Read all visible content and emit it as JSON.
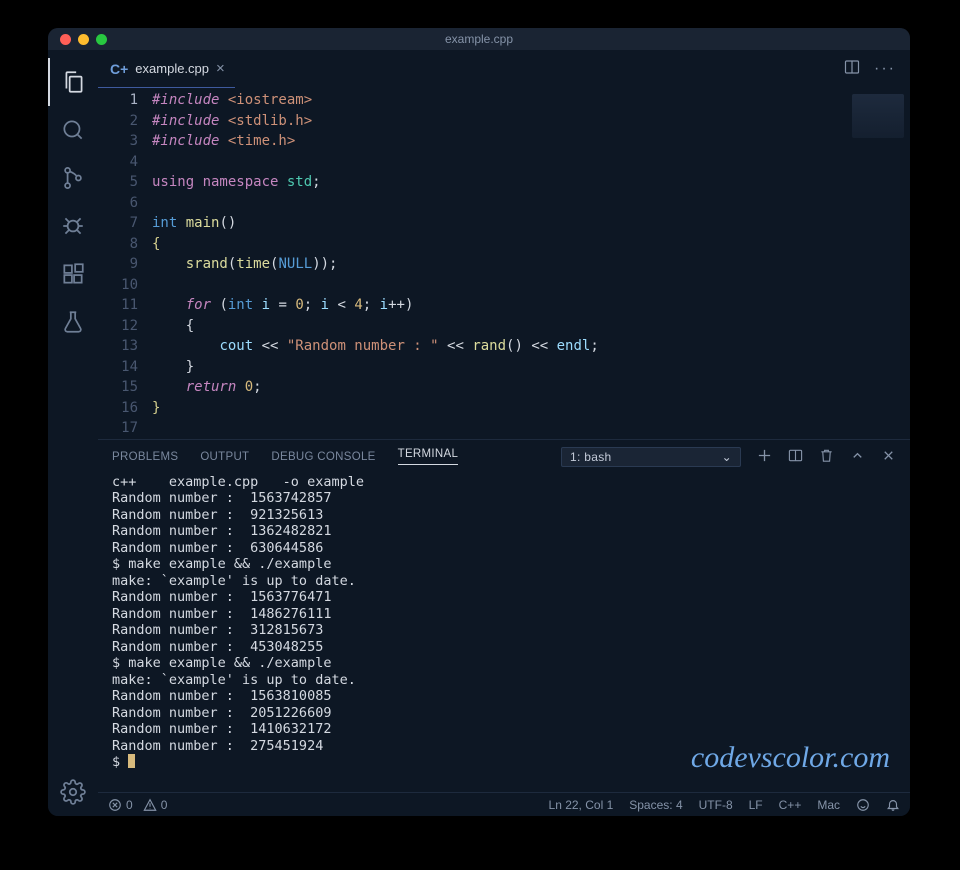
{
  "window": {
    "title": "example.cpp"
  },
  "tab": {
    "filename": "example.cpp",
    "icon_label": "C+"
  },
  "code_tokens": [
    [
      [
        "k-include",
        "#include "
      ],
      [
        "k-lib",
        "<iostream>"
      ]
    ],
    [
      [
        "k-include",
        "#include "
      ],
      [
        "k-lib",
        "<stdlib.h>"
      ]
    ],
    [
      [
        "k-include",
        "#include "
      ],
      [
        "k-lib",
        "<time.h>"
      ]
    ],
    [],
    [
      [
        "k-keyword",
        "using "
      ],
      [
        "k-keyword",
        "namespace "
      ],
      [
        "k-namespace",
        "std"
      ],
      [
        "k-punc",
        ";"
      ]
    ],
    [],
    [
      [
        "k-type",
        "int "
      ],
      [
        "k-func",
        "main"
      ],
      [
        "k-punc",
        "()"
      ]
    ],
    [
      [
        "k-brace-y",
        "{"
      ]
    ],
    [
      [
        "",
        "    "
      ],
      [
        "k-func",
        "srand"
      ],
      [
        "k-punc",
        "("
      ],
      [
        "k-func",
        "time"
      ],
      [
        "k-punc",
        "("
      ],
      [
        "k-const",
        "NULL"
      ],
      [
        "k-punc",
        "));"
      ]
    ],
    [],
    [
      [
        "",
        "    "
      ],
      [
        "k-keyword-i",
        "for "
      ],
      [
        "k-punc",
        "("
      ],
      [
        "k-type",
        "int "
      ],
      [
        "k-var",
        "i"
      ],
      [
        "k-punc",
        " = "
      ],
      [
        "k-num",
        "0"
      ],
      [
        "k-punc",
        "; "
      ],
      [
        "k-var",
        "i"
      ],
      [
        "k-punc",
        " < "
      ],
      [
        "k-num",
        "4"
      ],
      [
        "k-punc",
        "; "
      ],
      [
        "k-var",
        "i"
      ],
      [
        "k-punc",
        "++)"
      ]
    ],
    [
      [
        "",
        "    "
      ],
      [
        "k-brace",
        "{"
      ]
    ],
    [
      [
        "",
        "        "
      ],
      [
        "k-var",
        "cout"
      ],
      [
        "k-punc",
        " << "
      ],
      [
        "k-str",
        "\"Random number : \""
      ],
      [
        "k-punc",
        " << "
      ],
      [
        "k-func",
        "rand"
      ],
      [
        "k-punc",
        "() << "
      ],
      [
        "k-var",
        "endl"
      ],
      [
        "k-punc",
        ";"
      ]
    ],
    [
      [
        "",
        "    "
      ],
      [
        "k-brace",
        "}"
      ]
    ],
    [
      [
        "",
        "    "
      ],
      [
        "k-keyword-i",
        "return "
      ],
      [
        "k-num",
        "0"
      ],
      [
        "k-punc",
        ";"
      ]
    ],
    [
      [
        "k-brace-y",
        "}"
      ]
    ],
    []
  ],
  "line_count": 17,
  "panel": {
    "tabs": {
      "problems": "PROBLEMS",
      "output": "OUTPUT",
      "debug": "DEBUG CONSOLE",
      "terminal": "TERMINAL"
    },
    "terminal_selector": "1: bash"
  },
  "terminal_lines": [
    "c++    example.cpp   -o example",
    "Random number :  1563742857",
    "Random number :  921325613",
    "Random number :  1362482821",
    "Random number :  630644586",
    "$ make example && ./example",
    "make: `example' is up to date.",
    "Random number :  1563776471",
    "Random number :  1486276111",
    "Random number :  312815673",
    "Random number :  453048255",
    "$ make example && ./example",
    "make: `example' is up to date.",
    "Random number :  1563810085",
    "Random number :  2051226609",
    "Random number :  1410632172",
    "Random number :  275451924"
  ],
  "terminal_prompt": "$ ",
  "statusbar": {
    "errors": "0",
    "warnings": "0",
    "cursor": "Ln 22, Col 1",
    "spaces": "Spaces: 4",
    "encoding": "UTF-8",
    "eol": "LF",
    "language": "C++",
    "os": "Mac"
  },
  "watermark": "codevscolor.com"
}
